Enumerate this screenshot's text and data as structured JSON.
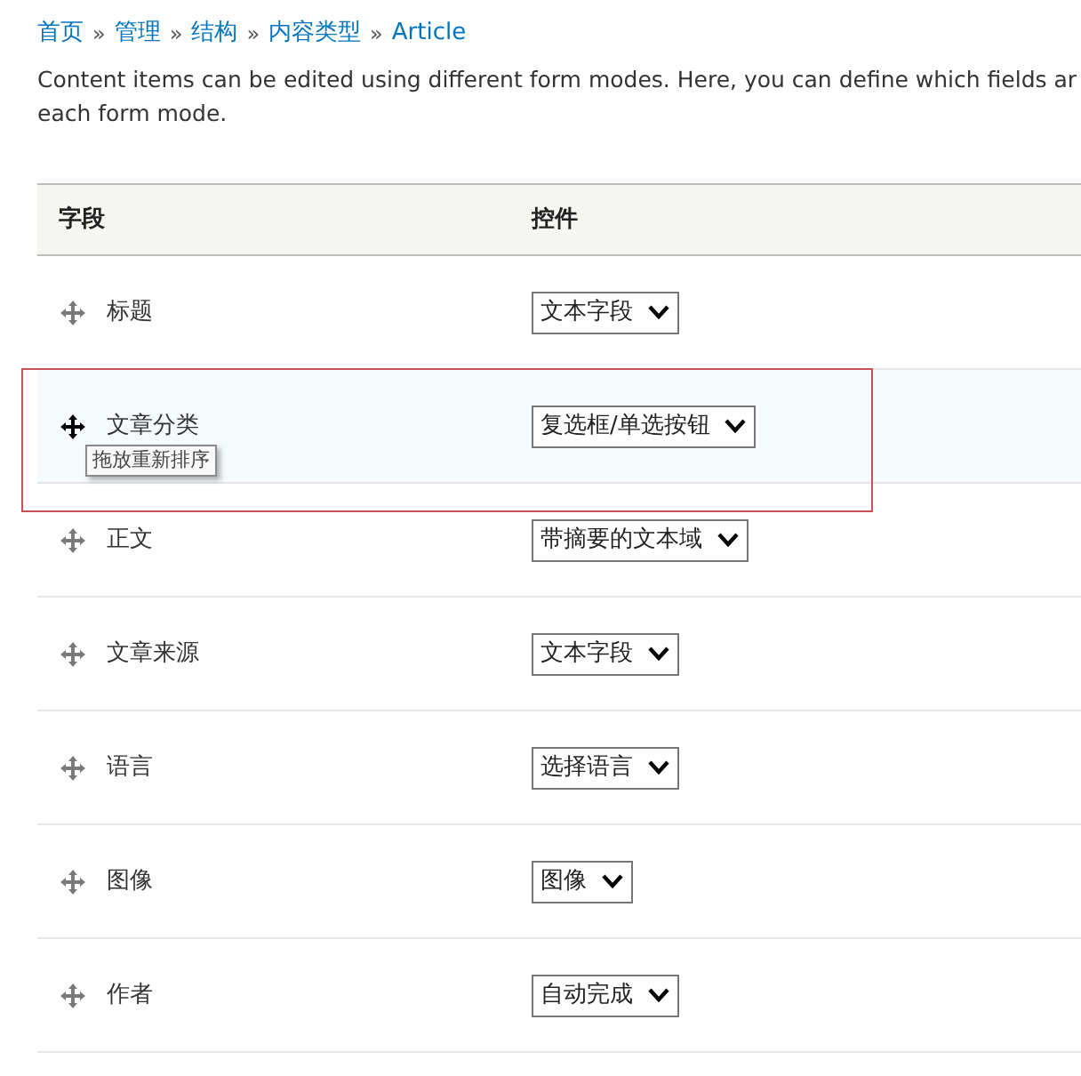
{
  "breadcrumb": [
    {
      "label": "首页"
    },
    {
      "label": "管理"
    },
    {
      "label": "结构"
    },
    {
      "label": "内容类型"
    },
    {
      "label": "Article"
    }
  ],
  "breadcrumb_separator": "»",
  "description": [
    "Content items can be edited using different form modes. Here, you can define which fields ar",
    "each form mode."
  ],
  "table": {
    "columns": [
      "字段",
      "控件"
    ],
    "rows": [
      {
        "field": "标题",
        "widget": "文本字段",
        "hovered": false
      },
      {
        "field": "文章分类",
        "widget": "复选框/单选按钮",
        "hovered": true,
        "tooltip": "拖放重新排序"
      },
      {
        "field": "正文",
        "widget": "带摘要的文本域",
        "hovered": false
      },
      {
        "field": "文章来源",
        "widget": "文本字段",
        "hovered": false
      },
      {
        "field": "语言",
        "widget": "选择语言",
        "hovered": false
      },
      {
        "field": "图像",
        "widget": "图像",
        "hovered": false
      },
      {
        "field": "作者",
        "widget": "自动完成",
        "hovered": false
      }
    ]
  }
}
